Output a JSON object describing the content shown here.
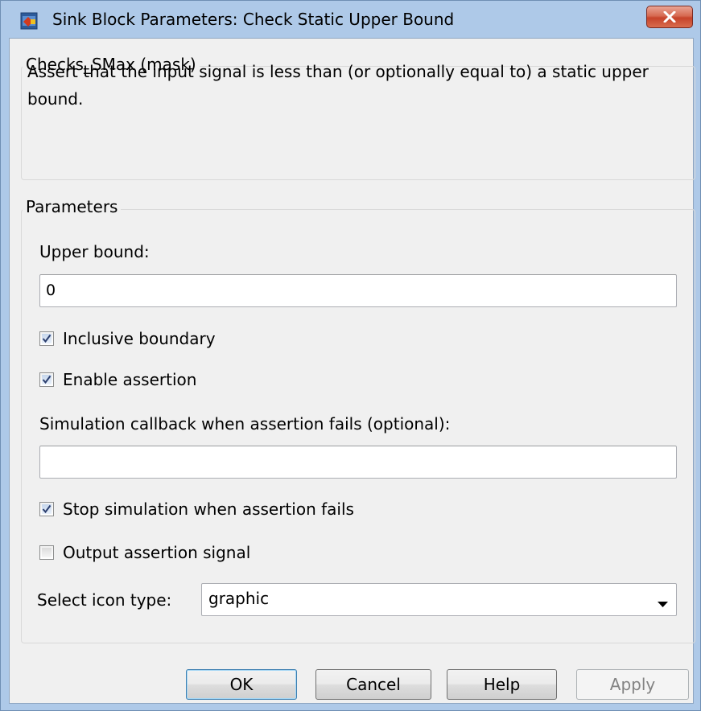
{
  "window": {
    "title": "Sink Block Parameters: Check Static Upper Bound",
    "icon": "simulink-block-icon",
    "close_icon": "close-icon"
  },
  "mask_group": {
    "legend": "Checks_SMax (mask)",
    "description": "Assert that the input signal is less than (or optionally equal to) a static upper bound."
  },
  "params_group": {
    "legend": "Parameters",
    "upper_bound_label": "Upper bound:",
    "upper_bound_value": "0",
    "inclusive_boundary": {
      "label": "Inclusive boundary",
      "checked": true
    },
    "enable_assertion": {
      "label": "Enable assertion",
      "checked": true
    },
    "callback_label": "Simulation callback when assertion fails (optional):",
    "callback_value": "",
    "stop_simulation": {
      "label": "Stop simulation when assertion fails",
      "checked": true
    },
    "output_signal": {
      "label": "Output assertion signal",
      "checked": false
    },
    "icon_type_label": "Select icon type:",
    "icon_type_value": "graphic"
  },
  "buttons": {
    "ok": "OK",
    "cancel": "Cancel",
    "help": "Help",
    "apply": "Apply"
  },
  "colors": {
    "title_bar": "#aec9e8",
    "client_bg": "#f0f0f0",
    "close_button": "#c6432a",
    "checkmark": "#2c3f6f"
  }
}
